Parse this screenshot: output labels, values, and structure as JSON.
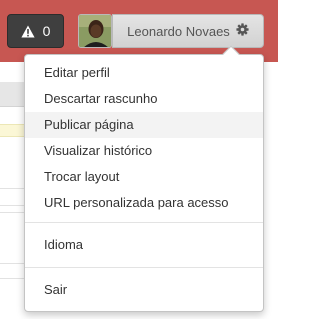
{
  "header": {
    "alert_count": "0",
    "user_name": "Leonardo Novaes"
  },
  "menu": {
    "items": [
      {
        "label": "Editar perfil"
      },
      {
        "label": "Descartar rascunho"
      },
      {
        "label": "Publicar página"
      },
      {
        "label": "Visualizar histórico"
      },
      {
        "label": "Trocar layout"
      },
      {
        "label": "URL personalizada para acesso"
      },
      {
        "label": "Idioma"
      },
      {
        "label": "Sair"
      }
    ],
    "highlighted_index": 2
  },
  "colors": {
    "topbar": "#c75752",
    "alert_button": "#3f3f3f"
  },
  "icons": [
    "warning-icon",
    "gear-icon"
  ]
}
